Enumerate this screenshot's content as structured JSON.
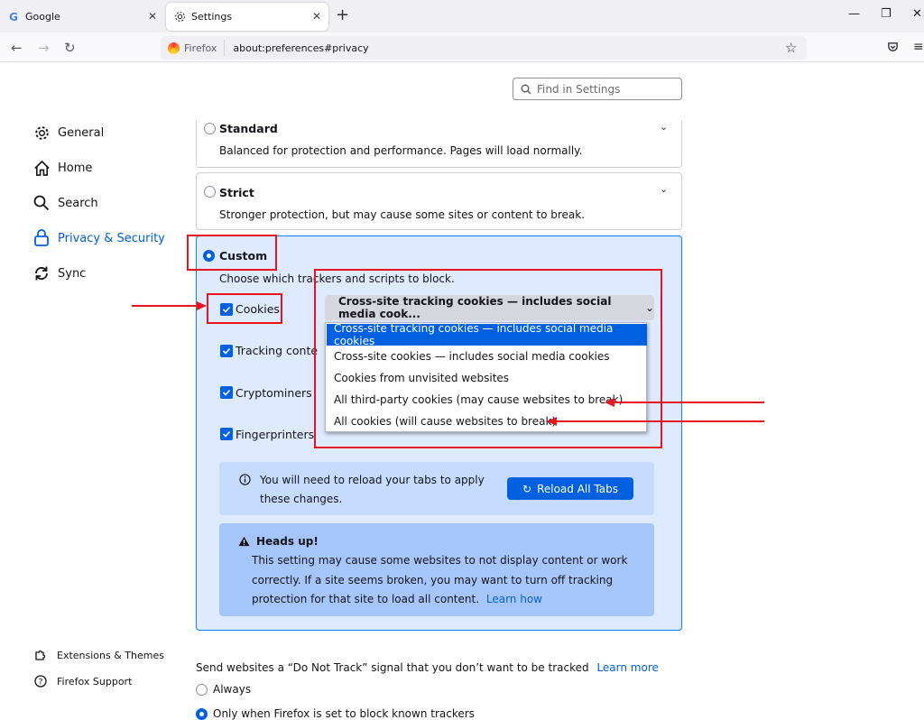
{
  "tabs": [
    {
      "title": "Google",
      "icon": "google-icon"
    },
    {
      "title": "Settings",
      "icon": "gear-icon"
    }
  ],
  "url": {
    "identity": "Firefox",
    "address": "about:preferences#privacy"
  },
  "find": {
    "placeholder": "Find in Settings"
  },
  "sidebar": {
    "items": [
      {
        "label": "General",
        "icon": "gear-icon"
      },
      {
        "label": "Home",
        "icon": "home-icon"
      },
      {
        "label": "Search",
        "icon": "search-icon"
      },
      {
        "label": "Privacy & Security",
        "icon": "lock-icon",
        "active": true
      },
      {
        "label": "Sync",
        "icon": "sync-icon"
      }
    ],
    "footer": [
      {
        "label": "Extensions & Themes",
        "icon": "puzzle-icon"
      },
      {
        "label": "Firefox Support",
        "icon": "help-icon"
      }
    ]
  },
  "protection": {
    "standard": {
      "label": "Standard",
      "desc": "Balanced for protection and performance. Pages will load normally."
    },
    "strict": {
      "label": "Strict",
      "desc": "Stronger protection, but may cause some sites or content to break."
    },
    "custom": {
      "label": "Custom",
      "desc": "Choose which trackers and scripts to block.",
      "options": [
        {
          "label": "Cookies",
          "checked": true
        },
        {
          "label": "Tracking content",
          "checked": true
        },
        {
          "label": "Cryptominers",
          "checked": true
        },
        {
          "label": "Fingerprinters",
          "checked": true
        }
      ],
      "cookie_select": {
        "value": "Cross-site tracking cookies — includes social media cook...",
        "options": [
          "Cross-site tracking cookies — includes social media cookies",
          "Cross-site cookies — includes social media cookies",
          "Cookies from unvisited websites",
          "All third-party cookies (may cause websites to break)",
          "All cookies (will cause websites to break)"
        ]
      },
      "reload_notice": {
        "text": "You will need to reload your tabs to apply these changes.",
        "button": "Reload All Tabs"
      },
      "heads_up": {
        "title": "Heads up!",
        "body": "This setting may cause some websites to not display content or work correctly. If a site seems broken, you may want to turn off tracking protection for that site to load all content.",
        "link": "Learn how"
      }
    }
  },
  "dnt": {
    "label": "Send websites a “Do Not Track” signal that you don’t want to be tracked",
    "link": "Learn more",
    "options": [
      "Always",
      "Only when Firefox is set to block known trackers"
    ]
  },
  "colors": {
    "accent": "#0061e0",
    "annotation": "#e8141f"
  }
}
